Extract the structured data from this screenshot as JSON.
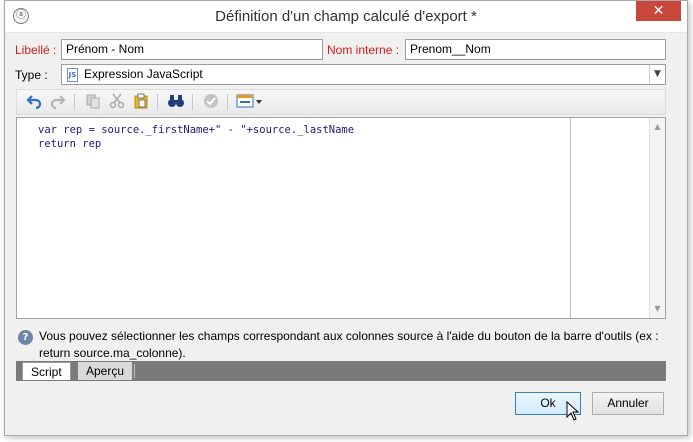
{
  "window": {
    "title": "Définition d'un champ calculé d'export *",
    "close_glyph": "✕",
    "app_icon_glyph": "ⓐ"
  },
  "form": {
    "label_label": "Libellé :",
    "label_value": "Prénom - Nom",
    "internal_name_label": "Nom interne :",
    "internal_name_value": "Prenom__Nom",
    "type_label": "Type :",
    "type_value": "Expression JavaScript",
    "type_icon": "javascript-file-icon"
  },
  "toolbar": {
    "icons": [
      "undo-icon",
      "redo-icon",
      "copy-icon",
      "cut-icon",
      "paste-icon",
      "find-binoculars-icon",
      "validate-check-icon",
      "insert-field-dropdown-icon"
    ]
  },
  "editor": {
    "code_line_1": "var rep = source._firstName+\" - \"+source._lastName",
    "code_line_2": "return rep"
  },
  "help": {
    "text": "Vous pouvez sélectionner les champs correspondant aux colonnes source à l'aide du bouton de la barre d'outils (ex : return source.ma_colonne)."
  },
  "tabs": {
    "script": "Script",
    "preview": "Aperçu"
  },
  "buttons": {
    "ok": "Ok",
    "cancel": "Annuler"
  },
  "colors": {
    "required_label": "#d41c1c",
    "close_button": "#c7473b",
    "tab_bar": "#7a7a7a",
    "code_text": "#1a1a80"
  }
}
